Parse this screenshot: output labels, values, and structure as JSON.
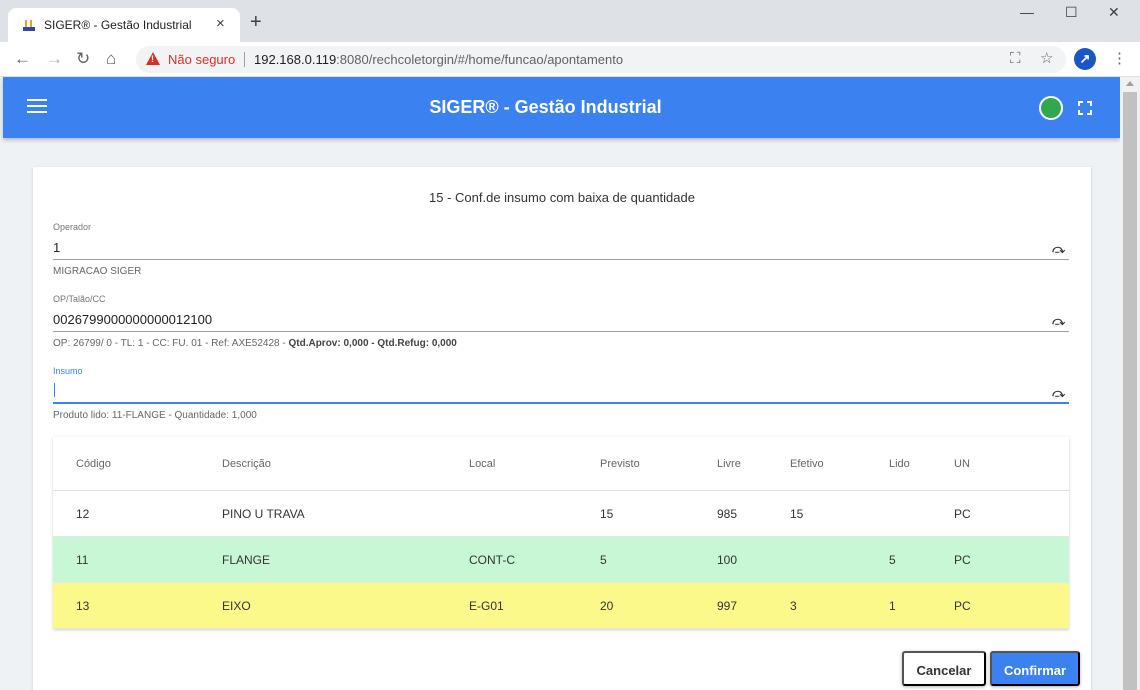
{
  "browser": {
    "tab_title": "SIGER® - Gestão Industrial",
    "tab_close": "×",
    "new_tab": "+",
    "window_controls": {
      "minimize": "—",
      "maximize": "☐",
      "close": "✕"
    },
    "insecure_label": "Não seguro",
    "url_host": "192.168.0.119",
    "url_path": ":8080/rechcoletorgin/#/home/funcao/apontamento",
    "nav": {
      "back": "←",
      "forward": "→",
      "reload": "↻",
      "home": "⌂"
    },
    "icons": {
      "translate": "⛶",
      "star": "☆",
      "menu": "⋮",
      "profile": "↗"
    }
  },
  "app": {
    "title": "SIGER® - Gestão Industrial",
    "status_color": "#2fa84f"
  },
  "form": {
    "title": "15 - Conf.de insumo com baixa de quantidade",
    "operador": {
      "label": "Operador",
      "value": "1",
      "hint": "MIGRACAO SIGER"
    },
    "op": {
      "label": "OP/Talão/CC",
      "value": "0026799000000000012100",
      "hint": "OP: 26799/ 0 - TL: 1 - CC: FU. 01 - Ref: AXE52428 - ",
      "hint_bold": "Qtd.Aprov: 0,000 - Qtd.Refug: 0,000"
    },
    "insumo": {
      "label": "Insumo",
      "value": "",
      "hint": "Produto lido: 11-FLANGE - Quantidade: 1,000"
    },
    "redo_icon": "⤼"
  },
  "table": {
    "headers": {
      "codigo": "Código",
      "descricao": "Descrição",
      "local": "Local",
      "previsto": "Previsto",
      "livre": "Livre",
      "efetivo": "Efetivo",
      "lido": "Lido",
      "un": "UN"
    },
    "rows": [
      {
        "codigo": "12",
        "descricao": "PINO U TRAVA",
        "local": "",
        "previsto": "15",
        "livre": "985",
        "efetivo": "15",
        "lido": "",
        "un": "PC"
      },
      {
        "codigo": "11",
        "descricao": "FLANGE",
        "local": "CONT-C",
        "previsto": "5",
        "livre": "100",
        "efetivo": "",
        "lido": "5",
        "un": "PC"
      },
      {
        "codigo": "13",
        "descricao": "EIXO",
        "local": "E-G01",
        "previsto": "20",
        "livre": "997",
        "efetivo": "3",
        "lido": "1",
        "un": "PC"
      }
    ],
    "row_colors": {
      "green": "#c8f7d6",
      "yellow": "#fbf98a"
    }
  },
  "actions": {
    "cancel": "Cancelar",
    "confirm": "Confirmar"
  },
  "colors": {
    "primary": "#3b82f0",
    "danger": "#d93025"
  }
}
